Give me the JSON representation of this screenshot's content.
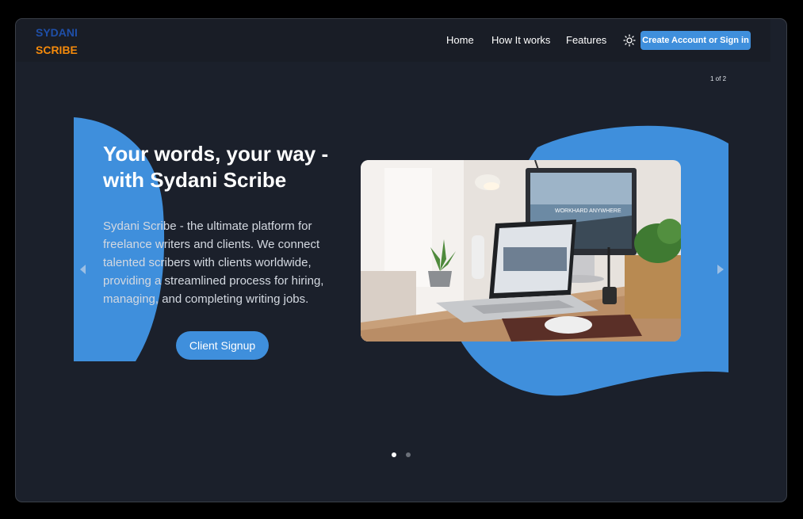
{
  "brand": {
    "line1": "SYDANI",
    "line2": "SCRIBE"
  },
  "nav": {
    "links": [
      "Home",
      "How It works",
      "Features"
    ],
    "cta_label": "Create Account or Sign in",
    "theme_icon": "sun-icon"
  },
  "carousel": {
    "counter": "1 of 2",
    "slide_count": 2,
    "active_index": 0,
    "prev_icon": "chevron-left-icon",
    "next_icon": "chevron-right-icon"
  },
  "hero": {
    "title": "Your words, your way - with Sydani Scribe",
    "description": "Sydani Scribe - the ultimate platform for freelance writers and clients. We connect talented scribers with clients worldwide, providing a streamlined process for hiring, managing, and completing writing jobs.",
    "signup_label": "Client Signup"
  },
  "laptop_screen_text": "WORKHARD ANYWHERE",
  "colors": {
    "accent": "#3f8fdc",
    "background": "#1b202b",
    "navbar": "#191d26",
    "brand_blue": "#1f4fa8",
    "brand_orange": "#f58a0b"
  }
}
